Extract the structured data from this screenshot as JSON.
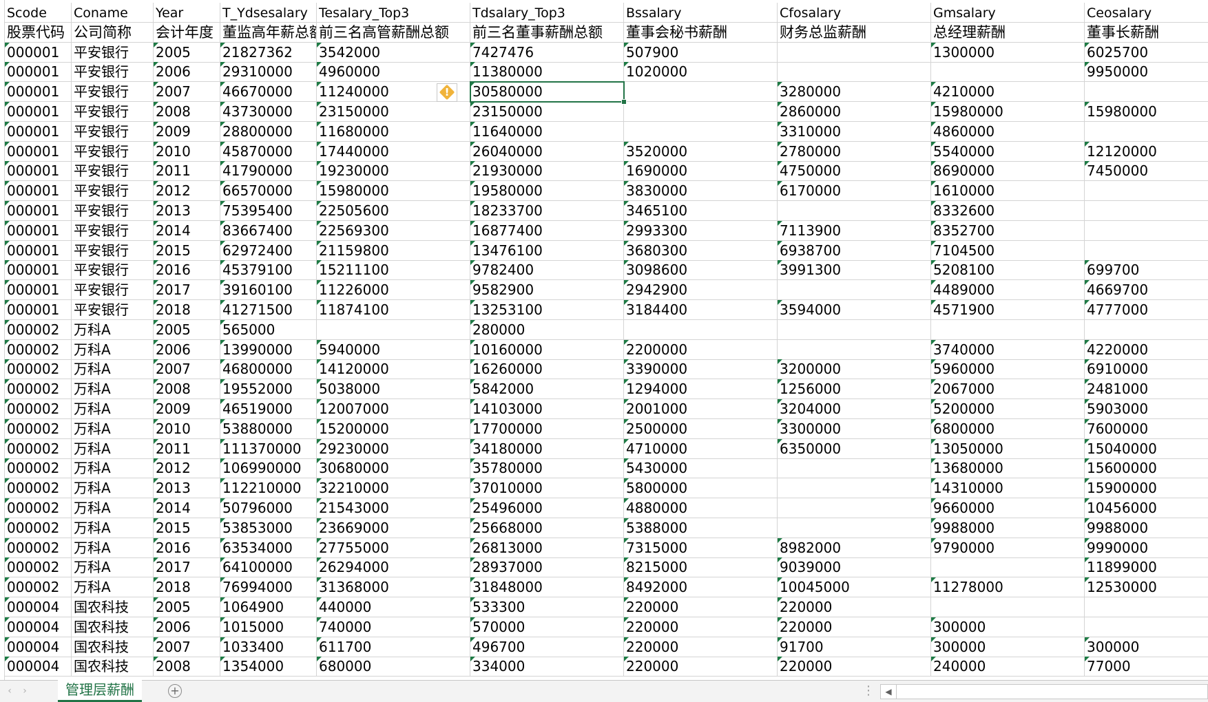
{
  "spreadsheet": {
    "headers_en": [
      "Scode",
      "Coname",
      "Year",
      "T_Ydsesalary",
      "Tesalary_Top3",
      "Tdsalary_Top3",
      "Bssalary",
      "Cfosalary",
      "Gmsalary",
      "Ceosalary"
    ],
    "headers_cn": [
      "股票代码",
      "公司简称",
      "会计年度",
      "董监高年薪总额",
      "前三名高管薪酬总额",
      "前三名董事薪酬总额",
      "董事会秘书薪酬",
      "财务总监薪酬",
      "总经理薪酬",
      "董事长薪酬"
    ],
    "rows": [
      [
        "000001",
        "平安银行",
        "2005",
        "21827362",
        "3542000",
        "7427476",
        "507900",
        "",
        "1300000",
        "6025700"
      ],
      [
        "000001",
        "平安银行",
        "2006",
        "29310000",
        "4960000",
        "11380000",
        "1020000",
        "",
        "",
        "9950000"
      ],
      [
        "000001",
        "平安银行",
        "2007",
        "46670000",
        "11240000",
        "30580000",
        "",
        "3280000",
        "4210000",
        ""
      ],
      [
        "000001",
        "平安银行",
        "2008",
        "43730000",
        "23150000",
        "23150000",
        "",
        "2860000",
        "15980000",
        "15980000"
      ],
      [
        "000001",
        "平安银行",
        "2009",
        "28800000",
        "11680000",
        "11640000",
        "",
        "3310000",
        "4860000",
        ""
      ],
      [
        "000001",
        "平安银行",
        "2010",
        "45870000",
        "17440000",
        "26040000",
        "3520000",
        "2780000",
        "5540000",
        "12120000"
      ],
      [
        "000001",
        "平安银行",
        "2011",
        "41790000",
        "19230000",
        "21930000",
        "1690000",
        "4750000",
        "8690000",
        "7450000"
      ],
      [
        "000001",
        "平安银行",
        "2012",
        "66570000",
        "15980000",
        "19580000",
        "3830000",
        "6170000",
        "1610000",
        ""
      ],
      [
        "000001",
        "平安银行",
        "2013",
        "75395400",
        "22505600",
        "18233700",
        "3465100",
        "",
        "8332600",
        ""
      ],
      [
        "000001",
        "平安银行",
        "2014",
        "83667400",
        "22569300",
        "16877400",
        "2993300",
        "7113900",
        "8352700",
        ""
      ],
      [
        "000001",
        "平安银行",
        "2015",
        "62972400",
        "21159800",
        "13476100",
        "3680300",
        "6938700",
        "7104500",
        ""
      ],
      [
        "000001",
        "平安银行",
        "2016",
        "45379100",
        "15211100",
        "9782400",
        "3098600",
        "3991300",
        "5208100",
        "699700"
      ],
      [
        "000001",
        "平安银行",
        "2017",
        "39160100",
        "11226000",
        "9582900",
        "2942900",
        "",
        "4489000",
        "4669700"
      ],
      [
        "000001",
        "平安银行",
        "2018",
        "41271500",
        "11874100",
        "13253100",
        "3184400",
        "3594000",
        "4571900",
        "4777000"
      ],
      [
        "000002",
        "万科A",
        "2005",
        "565000",
        "",
        "280000",
        "",
        "",
        "",
        ""
      ],
      [
        "000002",
        "万科A",
        "2006",
        "13990000",
        "5940000",
        "10160000",
        "2200000",
        "",
        "3740000",
        "4220000"
      ],
      [
        "000002",
        "万科A",
        "2007",
        "46800000",
        "14120000",
        "16260000",
        "3390000",
        "3200000",
        "5960000",
        "6910000"
      ],
      [
        "000002",
        "万科A",
        "2008",
        "19552000",
        "5038000",
        "5842000",
        "1294000",
        "1256000",
        "2067000",
        "2481000"
      ],
      [
        "000002",
        "万科A",
        "2009",
        "46519000",
        "12007000",
        "14103000",
        "2001000",
        "3204000",
        "5200000",
        "5903000"
      ],
      [
        "000002",
        "万科A",
        "2010",
        "53880000",
        "15200000",
        "17700000",
        "2500000",
        "3300000",
        "6800000",
        "7600000"
      ],
      [
        "000002",
        "万科A",
        "2011",
        "111370000",
        "29230000",
        "34180000",
        "4710000",
        "6350000",
        "13050000",
        "15040000"
      ],
      [
        "000002",
        "万科A",
        "2012",
        "106990000",
        "30680000",
        "35780000",
        "5430000",
        "",
        "13680000",
        "15600000"
      ],
      [
        "000002",
        "万科A",
        "2013",
        "112210000",
        "32210000",
        "37010000",
        "5800000",
        "",
        "14310000",
        "15900000"
      ],
      [
        "000002",
        "万科A",
        "2014",
        "50796000",
        "21543000",
        "25496000",
        "4880000",
        "",
        "9660000",
        "10456000"
      ],
      [
        "000002",
        "万科A",
        "2015",
        "53853000",
        "23669000",
        "25668000",
        "5388000",
        "",
        "9988000",
        "9988000"
      ],
      [
        "000002",
        "万科A",
        "2016",
        "63534000",
        "27755000",
        "26813000",
        "7315000",
        "8982000",
        "9790000",
        "9990000"
      ],
      [
        "000002",
        "万科A",
        "2017",
        "64100000",
        "26294000",
        "28937000",
        "8215000",
        "9039000",
        "",
        "11899000"
      ],
      [
        "000002",
        "万科A",
        "2018",
        "76994000",
        "31368000",
        "31848000",
        "8492000",
        "10045000",
        "11278000",
        "12530000"
      ],
      [
        "000004",
        "国农科技",
        "2005",
        "1064900",
        "440000",
        "533300",
        "220000",
        "220000",
        "",
        ""
      ],
      [
        "000004",
        "国农科技",
        "2006",
        "1015000",
        "740000",
        "570000",
        "220000",
        "220000",
        "300000",
        ""
      ],
      [
        "000004",
        "国农科技",
        "2007",
        "1033400",
        "611700",
        "496700",
        "220000",
        "91700",
        "300000",
        "300000"
      ],
      [
        "000004",
        "国农科技",
        "2008",
        "1354000",
        "680000",
        "334000",
        "220000",
        "220000",
        "240000",
        "77000"
      ]
    ]
  },
  "warning_badge": {
    "glyph": "!",
    "icon": "warning-diamond-icon"
  },
  "sheet_tab": {
    "label": "管理层薪酬"
  },
  "add_sheet": {
    "glyph": "+"
  },
  "nav": {
    "prev_glyph": "‹",
    "next_glyph": "›"
  },
  "colors": {
    "accent": "#217346",
    "grid": "#d4d4d4",
    "error_triangle": "#1e7b45",
    "warning": "#f0b33a"
  }
}
